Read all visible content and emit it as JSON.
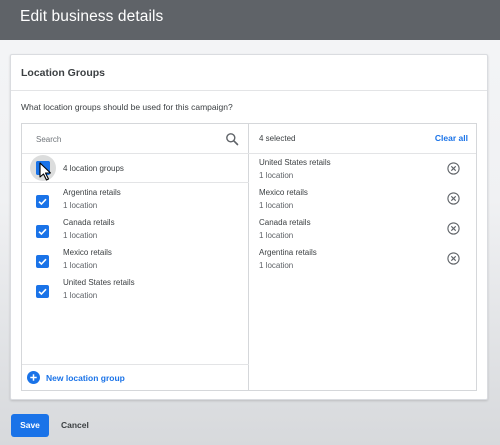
{
  "header": {
    "title": "Edit business details"
  },
  "card": {
    "title": "Location Groups",
    "question": "What location groups should be used for this campaign?"
  },
  "left_panel": {
    "search_placeholder": "Search",
    "group_header_label": "4 location groups",
    "items": [
      {
        "name": "Argentina retails",
        "count": "1 location",
        "checked": true
      },
      {
        "name": "Canada retails",
        "count": "1 location",
        "checked": true
      },
      {
        "name": "Mexico retails",
        "count": "1 location",
        "checked": true
      },
      {
        "name": "United States retails",
        "count": "1 location",
        "checked": true
      }
    ],
    "new_group_label": "New location group"
  },
  "right_panel": {
    "selected_count": "4 selected",
    "clear_all_label": "Clear all",
    "items": [
      {
        "name": "United States retails",
        "count": "1 location"
      },
      {
        "name": "Mexico retails",
        "count": "1 location"
      },
      {
        "name": "Canada retails",
        "count": "1 location"
      },
      {
        "name": "Argentina retails",
        "count": "1 location"
      }
    ]
  },
  "footer": {
    "save_label": "Save",
    "cancel_label": "Cancel"
  },
  "colors": {
    "accent": "#1a73e8",
    "header_bg": "#5f6368",
    "text": "#3c4043",
    "muted_text": "#5f6368"
  },
  "icons": {
    "search": "search-icon",
    "checkbox": "checkbox-checked-icon",
    "add": "add-circle-icon",
    "remove": "remove-circle-icon",
    "cursor": "mouse-pointer-icon"
  }
}
